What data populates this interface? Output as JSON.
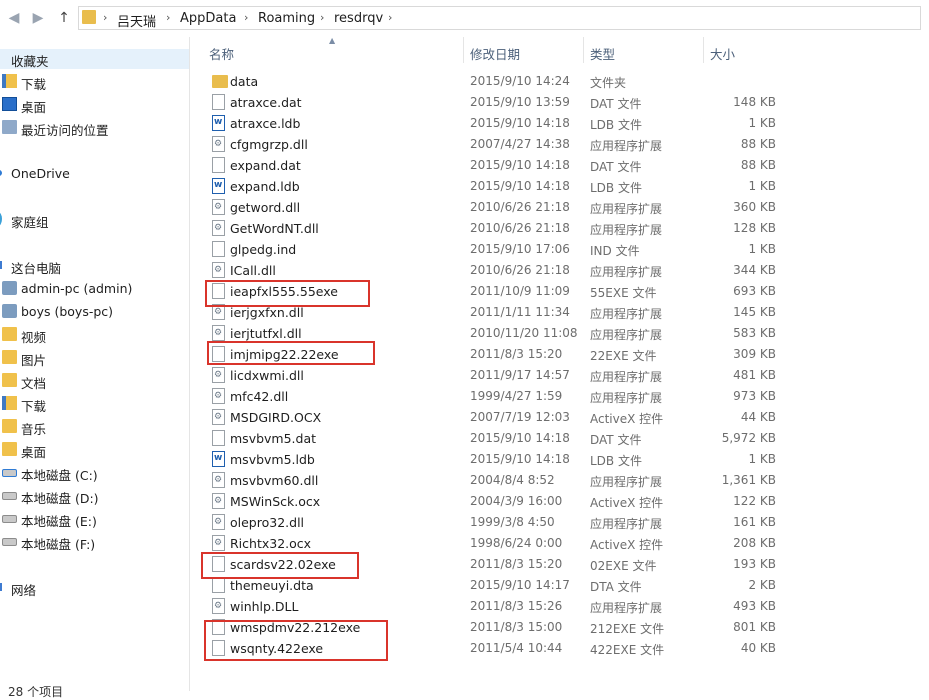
{
  "addressbar": {
    "back_icon": "back-arrow-icon",
    "forward_icon": "forward-arrow-icon",
    "up_icon": "up-arrow-icon",
    "breadcrumbs": [
      "吕天瑞",
      "AppData",
      "Roaming",
      "resdrqv"
    ]
  },
  "sidebar": {
    "favorites_label": "收藏夹",
    "favorites": [
      "下载",
      "桌面",
      "最近访问的位置"
    ],
    "onedrive_label": "OneDrive",
    "homegroup_label": "家庭组",
    "pc_label": "这台电脑",
    "pc_items": [
      "admin-pc (admin)",
      "boys (boys-pc)",
      "视频",
      "图片",
      "文档",
      "下载",
      "音乐",
      "桌面",
      "本地磁盘 (C:)",
      "本地磁盘 (D:)",
      "本地磁盘 (E:)",
      "本地磁盘 (F:)"
    ],
    "network_label": "网络"
  },
  "columns": {
    "name": "名称",
    "date": "修改日期",
    "type": "类型",
    "size": "大小"
  },
  "files": [
    {
      "name": "data",
      "date": "2015/9/10 14:24",
      "type": "文件夹",
      "size": "",
      "icon": "folder"
    },
    {
      "name": "atraxce.dat",
      "date": "2015/9/10 13:59",
      "type": "DAT 文件",
      "size": "148 KB",
      "icon": "file"
    },
    {
      "name": "atraxce.ldb",
      "date": "2015/9/10 14:18",
      "type": "LDB 文件",
      "size": "1 KB",
      "icon": "ldb"
    },
    {
      "name": "cfgmgrzp.dll",
      "date": "2007/4/27 14:38",
      "type": "应用程序扩展",
      "size": "88 KB",
      "icon": "dll"
    },
    {
      "name": "expand.dat",
      "date": "2015/9/10 14:18",
      "type": "DAT 文件",
      "size": "88 KB",
      "icon": "file"
    },
    {
      "name": "expand.ldb",
      "date": "2015/9/10 14:18",
      "type": "LDB 文件",
      "size": "1 KB",
      "icon": "ldb"
    },
    {
      "name": "getword.dll",
      "date": "2010/6/26 21:18",
      "type": "应用程序扩展",
      "size": "360 KB",
      "icon": "dll"
    },
    {
      "name": "GetWordNT.dll",
      "date": "2010/6/26 21:18",
      "type": "应用程序扩展",
      "size": "128 KB",
      "icon": "dll"
    },
    {
      "name": "glpedg.ind",
      "date": "2015/9/10 17:06",
      "type": "IND 文件",
      "size": "1 KB",
      "icon": "file"
    },
    {
      "name": "ICall.dll",
      "date": "2010/6/26 21:18",
      "type": "应用程序扩展",
      "size": "344 KB",
      "icon": "dll"
    },
    {
      "name": "ieapfxl555.55exe",
      "date": "2011/10/9 11:09",
      "type": "55EXE 文件",
      "size": "693 KB",
      "icon": "file"
    },
    {
      "name": "ierjgxfxn.dll",
      "date": "2011/1/11 11:34",
      "type": "应用程序扩展",
      "size": "145 KB",
      "icon": "dll"
    },
    {
      "name": "ierjtutfxl.dll",
      "date": "2010/11/20 11:08",
      "type": "应用程序扩展",
      "size": "583 KB",
      "icon": "dll"
    },
    {
      "name": "imjmipg22.22exe",
      "date": "2011/8/3 15:20",
      "type": "22EXE 文件",
      "size": "309 KB",
      "icon": "file"
    },
    {
      "name": "licdxwmi.dll",
      "date": "2011/9/17 14:57",
      "type": "应用程序扩展",
      "size": "481 KB",
      "icon": "dll"
    },
    {
      "name": "mfc42.dll",
      "date": "1999/4/27 1:59",
      "type": "应用程序扩展",
      "size": "973 KB",
      "icon": "dll"
    },
    {
      "name": "MSDGIRD.OCX",
      "date": "2007/7/19 12:03",
      "type": "ActiveX 控件",
      "size": "44 KB",
      "icon": "dll"
    },
    {
      "name": "msvbvm5.dat",
      "date": "2015/9/10 14:18",
      "type": "DAT 文件",
      "size": "5,972 KB",
      "icon": "file"
    },
    {
      "name": "msvbvm5.ldb",
      "date": "2015/9/10 14:18",
      "type": "LDB 文件",
      "size": "1 KB",
      "icon": "ldb"
    },
    {
      "name": "msvbvm60.dll",
      "date": "2004/8/4 8:52",
      "type": "应用程序扩展",
      "size": "1,361 KB",
      "icon": "dll"
    },
    {
      "name": "MSWinSck.ocx",
      "date": "2004/3/9 16:00",
      "type": "ActiveX 控件",
      "size": "122 KB",
      "icon": "dll"
    },
    {
      "name": "olepro32.dll",
      "date": "1999/3/8 4:50",
      "type": "应用程序扩展",
      "size": "161 KB",
      "icon": "dll"
    },
    {
      "name": "Richtx32.ocx",
      "date": "1998/6/24 0:00",
      "type": "ActiveX 控件",
      "size": "208 KB",
      "icon": "dll"
    },
    {
      "name": "scardsv22.02exe",
      "date": "2011/8/3 15:20",
      "type": "02EXE 文件",
      "size": "193 KB",
      "icon": "file"
    },
    {
      "name": "themeuyi.dta",
      "date": "2015/9/10 14:17",
      "type": "DTA 文件",
      "size": "2 KB",
      "icon": "file"
    },
    {
      "name": "winhlp.DLL",
      "date": "2011/8/3 15:26",
      "type": "应用程序扩展",
      "size": "493 KB",
      "icon": "dll"
    },
    {
      "name": "wmspdmv22.212exe",
      "date": "2011/8/3 15:00",
      "type": "212EXE 文件",
      "size": "801 KB",
      "icon": "file"
    },
    {
      "name": "wsqnty.422exe",
      "date": "2011/5/4 10:44",
      "type": "422EXE 文件",
      "size": "40 KB",
      "icon": "file"
    }
  ],
  "highlighted": [
    "ieapfxl555.55exe",
    "imjmipg22.22exe",
    "scardsv22.02exe",
    "wmspdmv22.212exe",
    "wsqnty.422exe"
  ],
  "highlight_color": "#d9342b",
  "status_text": "28 个项目"
}
